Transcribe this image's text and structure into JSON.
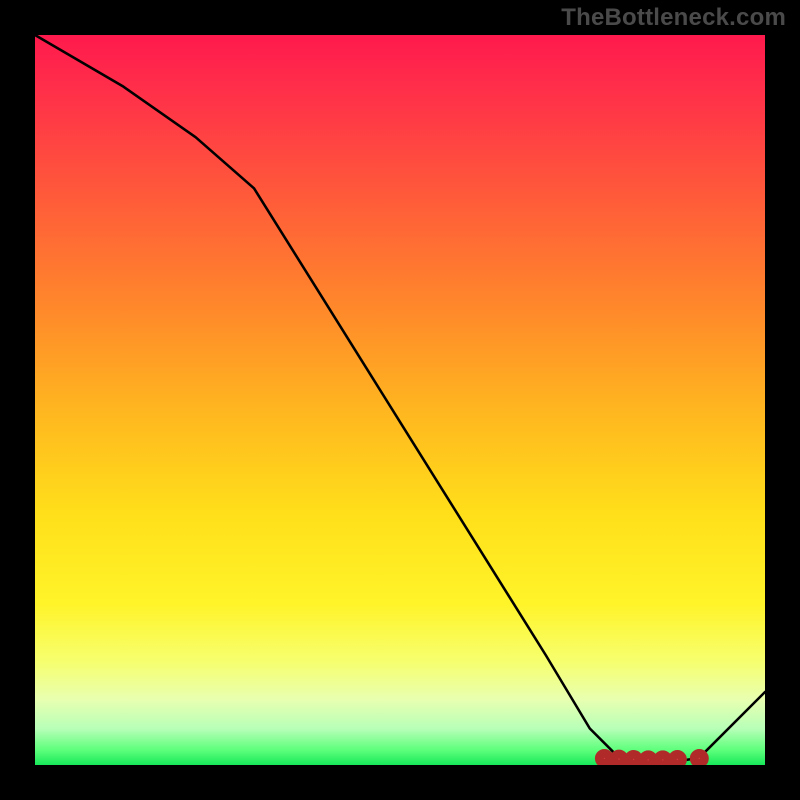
{
  "watermark": "TheBottleneck.com",
  "chart_data": {
    "type": "line",
    "title": "",
    "xlabel": "",
    "ylabel": "",
    "xlim": [
      0,
      100
    ],
    "ylim": [
      0,
      100
    ],
    "x": [
      0,
      12,
      22,
      30,
      40,
      50,
      60,
      70,
      76,
      80,
      84,
      88,
      91,
      100
    ],
    "values": [
      100,
      93,
      86,
      79,
      63,
      47,
      31,
      15,
      5,
      1,
      0.5,
      0.5,
      1,
      10
    ],
    "flat_segment": {
      "x_start": 78,
      "x_end": 91,
      "y": 0.7
    },
    "markers": {
      "x": [
        78,
        80,
        82,
        84,
        86,
        88,
        91
      ],
      "y": [
        0.9,
        0.8,
        0.75,
        0.7,
        0.7,
        0.75,
        0.9
      ]
    },
    "background_gradient": {
      "direction": "vertical",
      "stops": [
        {
          "pos": 0.0,
          "color": "#ff1a4d"
        },
        {
          "pos": 0.22,
          "color": "#ff5a3a"
        },
        {
          "pos": 0.52,
          "color": "#ffb81f"
        },
        {
          "pos": 0.78,
          "color": "#fff42a"
        },
        {
          "pos": 0.95,
          "color": "#b8ffb8"
        },
        {
          "pos": 1.0,
          "color": "#18e85a"
        }
      ]
    }
  }
}
